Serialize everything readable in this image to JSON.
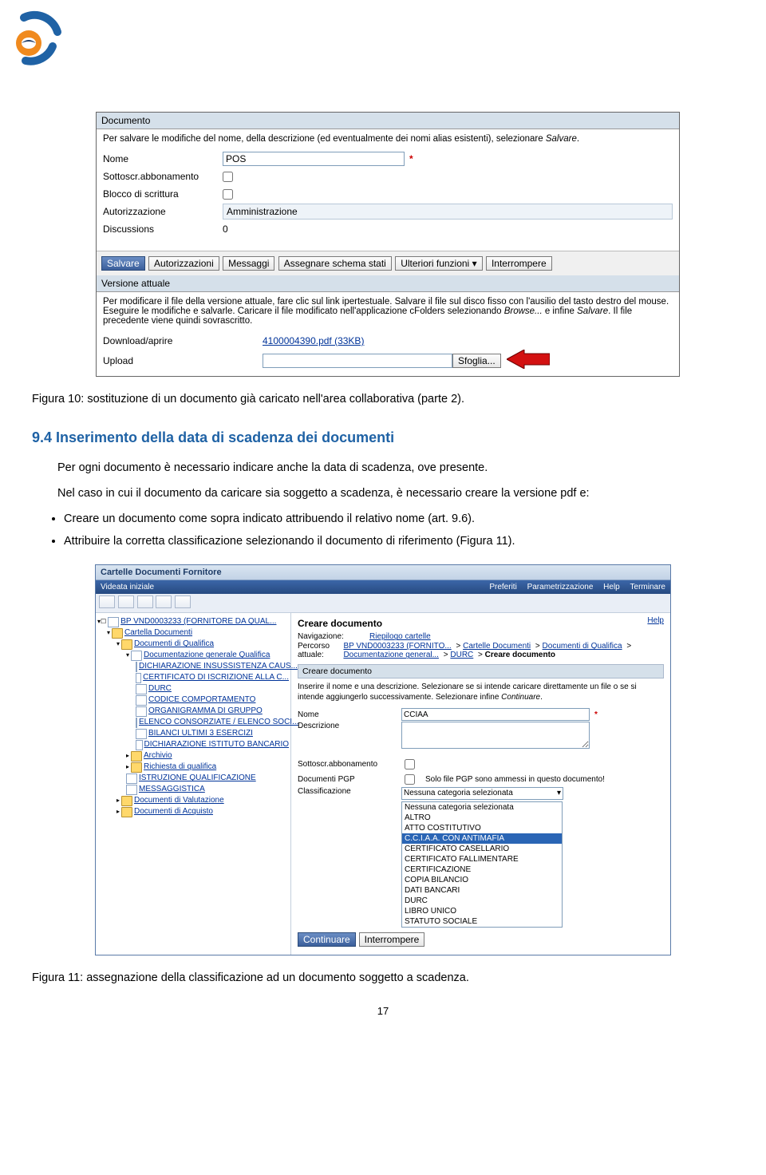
{
  "logo": {
    "alt": "logo"
  },
  "embed1": {
    "section1_title": "Documento",
    "section1_note_pre": "Per salvare le modifiche del nome, della descrizione (ed eventualmente dei nomi alias esistenti), selezionare ",
    "section1_note_em": "Salvare",
    "labels": {
      "nome": "Nome",
      "sottoscr": "Sottoscr.abbonamento",
      "blocco": "Blocco di scrittura",
      "autorizz": "Autorizzazione",
      "discuss": "Discussions"
    },
    "values": {
      "nome": "POS",
      "autorizz": "Amministrazione",
      "discuss": "0"
    },
    "buttons": [
      "Salvare",
      "Autorizzazioni",
      "Messaggi",
      "Assegnare schema stati",
      "Ulteriori funzioni",
      "Interrompere"
    ],
    "section2_title": "Versione attuale",
    "section2_note_pre": "Per modificare il file della versione attuale, fare clic sul link ipertestuale. Salvare il file sul disco fisso con l'ausilio del tasto destro del mouse. Eseguire le modifiche e salvarle. Caricare il file modificato nell'applicazione cFolders selezionando ",
    "section2_note_em1": "Browse...",
    "section2_note_mid": " e infine ",
    "section2_note_em2": "Salvare",
    "section2_note_post": ". Il file precedente viene quindi sovrascritto.",
    "download_label": "Download/aprire",
    "download_link": "4100004390.pdf (33KB)",
    "upload_label": "Upload",
    "sfoglia_btn": "Sfoglia..."
  },
  "caption1": "Figura 10: sostituzione di un documento già caricato nell'area collaborativa (parte 2).",
  "heading": "9.4    Inserimento della data di scadenza dei documenti",
  "para1": "Per ogni documento è necessario indicare anche la data di scadenza, ove presente.",
  "para2": "Nel caso in cui il documento da caricare sia soggetto a scadenza, è necessario creare la versione pdf e:",
  "bullet1": "Creare un documento come sopra indicato attribuendo il relativo nome (art. 9.6).",
  "bullet2": "Attribuire la corretta classificazione selezionando il documento di riferimento (Figura 11).",
  "embed2": {
    "title": "Cartelle Documenti Fornitore",
    "nav_left": "Videata iniziale",
    "nav_right": [
      "Preferiti",
      "Parametrizzazione",
      "Help",
      "Terminare"
    ],
    "tree": [
      {
        "depth": 0,
        "ico": "pg",
        "text": "BP VND0003233 (FORNITORE DA QUAL...",
        "link": true,
        "prefix": "▾☐"
      },
      {
        "depth": 1,
        "ico": "fldy",
        "text": "Cartella Documenti",
        "link": true,
        "prefix": "▾"
      },
      {
        "depth": 2,
        "ico": "fldy",
        "text": "Documenti di Qualifica",
        "link": true,
        "prefix": "▾"
      },
      {
        "depth": 3,
        "ico": "fldw",
        "text": "Documentazione generale Qualifica",
        "link": true,
        "prefix": "▾"
      },
      {
        "depth": 4,
        "ico": "pg",
        "text": "DICHIARAZIONE INSUSSISTENZA CAUS...",
        "link": true
      },
      {
        "depth": 4,
        "ico": "pg",
        "text": "CERTIFICATO DI ISCRIZIONE ALLA C...",
        "link": true
      },
      {
        "depth": 4,
        "ico": "pg",
        "text": "DURC",
        "link": true
      },
      {
        "depth": 4,
        "ico": "pg",
        "text": "CODICE COMPORTAMENTO",
        "link": true
      },
      {
        "depth": 4,
        "ico": "pg",
        "text": "ORGANIGRAMMA DI GRUPPO",
        "link": true
      },
      {
        "depth": 4,
        "ico": "pg",
        "text": "ELENCO CONSORZIATE / ELENCO SOCI...",
        "link": true
      },
      {
        "depth": 4,
        "ico": "pg",
        "text": "BILANCI ULTIMI 3 ESERCIZI",
        "link": true
      },
      {
        "depth": 4,
        "ico": "pg",
        "text": "DICHIARAZIONE ISTITUTO BANCARIO",
        "link": true
      },
      {
        "depth": 3,
        "ico": "fldy",
        "text": "Archivio",
        "link": true,
        "prefix": "▸"
      },
      {
        "depth": 3,
        "ico": "fldy",
        "text": "Richiesta di qualifica",
        "link": true,
        "prefix": "▸"
      },
      {
        "depth": 3,
        "ico": "pg",
        "text": "ISTRUZIONE QUALIFICAZIONE",
        "link": true
      },
      {
        "depth": 3,
        "ico": "pg",
        "text": "MESSAGGISTICA",
        "link": true
      },
      {
        "depth": 2,
        "ico": "fldy",
        "text": "Documenti di Valutazione",
        "link": true,
        "prefix": "▸"
      },
      {
        "depth": 2,
        "ico": "fldy",
        "text": "Documenti di Acquisto",
        "link": true,
        "prefix": "▸"
      }
    ],
    "maint": "Creare documento",
    "nav_label": "Navigazione:",
    "nav_val": "Riepilogo cartelle",
    "path_label": "Percorso attuale:",
    "path": [
      "BP VND0003233 (FORNITO...",
      "Cartelle Documenti",
      "Documenti di Qualifica",
      "Documentazione general..."
    ],
    "path_tail1": "DURC",
    "path_tail2": "Creare documento",
    "sect_title": "Creare documento",
    "note_pre": "Inserire il nome e una descrizione. Selezionare se si intende caricare direttamente un file o se si intende aggiungerlo successivamente. Selezionare infine ",
    "note_em": "Continuare",
    "lbl_nome": "Nome",
    "val_nome": "CCIAA",
    "lbl_descr": "Descrizione",
    "lbl_sott": "Sottoscr.abbonamento",
    "lbl_pgp": "Documenti PGP",
    "val_pgp": "Solo file PGP sono ammessi in questo documento!",
    "lbl_class": "Classificazione",
    "class_sel": "Nessuna categoria selezionata",
    "class_list": [
      "Nessuna categoria selezionata",
      "ALTRO",
      "ATTO COSTITUTIVO",
      "C.C.I.A.A. CON ANTIMAFIA",
      "CERTIFICATO CASELLARIO",
      "CERTIFICATO FALLIMENTARE",
      "CERTIFICAZIONE",
      "COPIA BILANCIO",
      "DATI BANCARI",
      "DURC",
      "LIBRO UNICO",
      "STATUTO SOCIALE"
    ],
    "class_selected_index": 3,
    "btn_cont": "Continuare",
    "btn_int": "Interrompere",
    "help": "Help"
  },
  "caption2": "Figura 11: assegnazione della classificazione ad un documento soggetto a scadenza.",
  "page_num": "17"
}
